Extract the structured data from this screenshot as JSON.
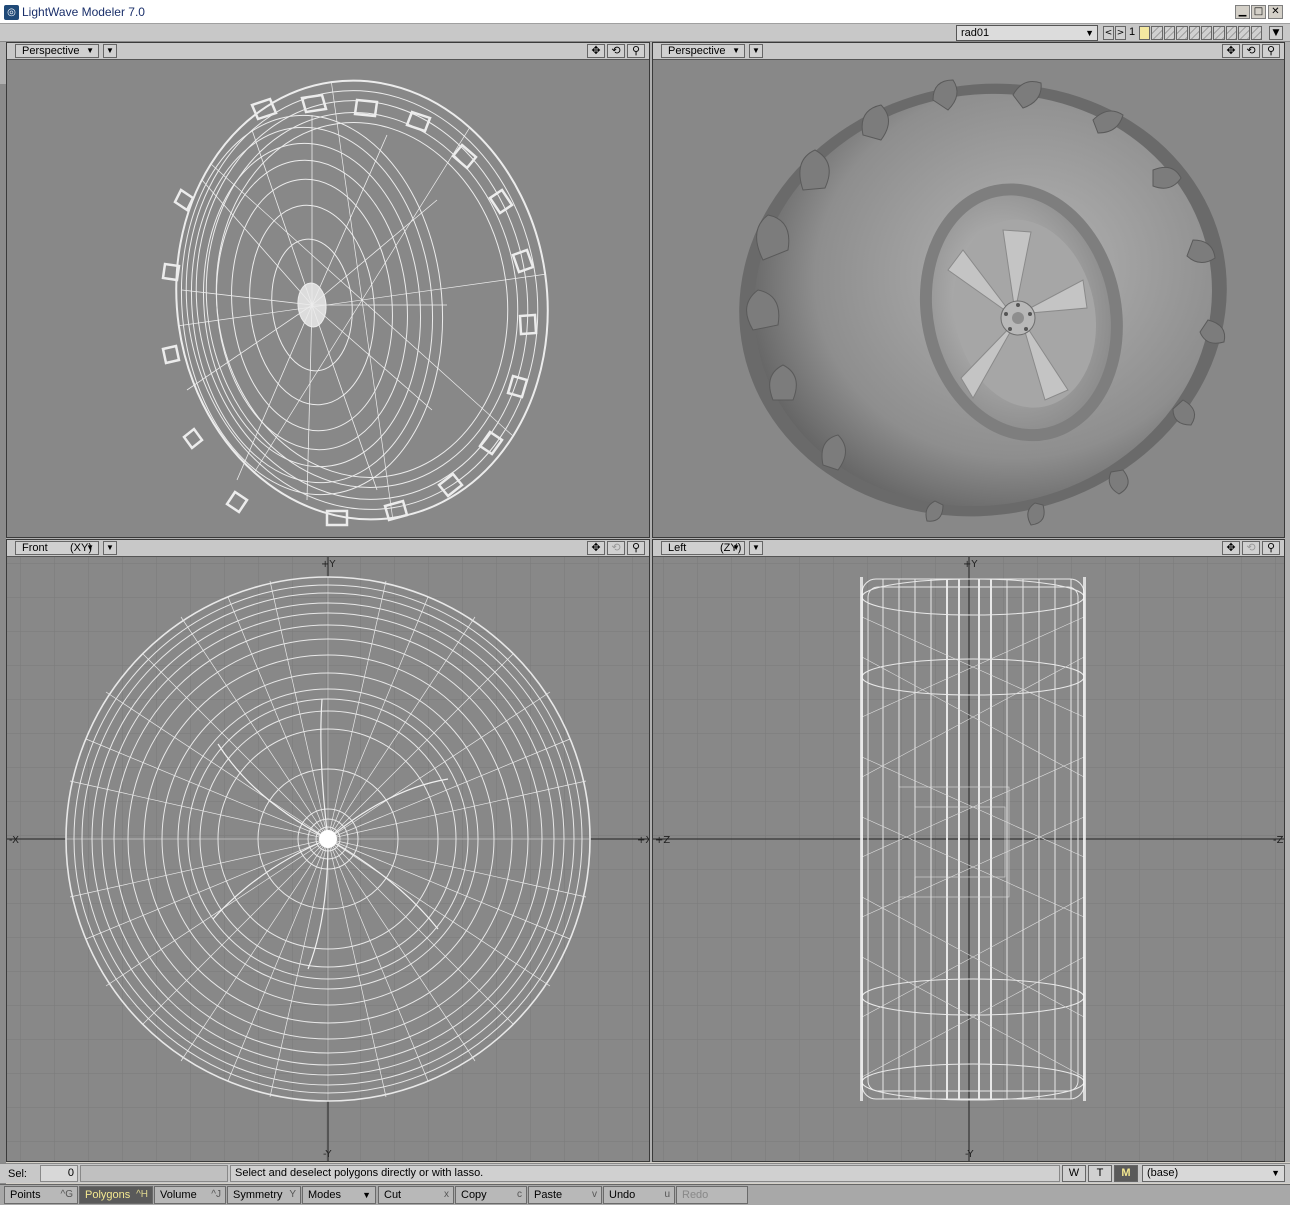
{
  "window": {
    "title": "LightWave Modeler 7.0",
    "minimize": "▁",
    "maximize": "□",
    "close": "✕"
  },
  "topbar": {
    "layer_name": "rad01",
    "layer_number": "1",
    "prev": "<",
    "next": ">"
  },
  "viewports": {
    "top_left": {
      "view": "Perspective",
      "axis": ""
    },
    "top_right": {
      "view": "Perspective",
      "axis": ""
    },
    "bottom_left": {
      "view": "Front",
      "axis": "(XY)",
      "h_neg": "-X",
      "h_pos": "+X",
      "v_pos": "+Y",
      "v_neg": "-Y"
    },
    "bottom_right": {
      "view": "Left",
      "axis": "(ZY)",
      "h_neg": "+Z",
      "h_pos": "-Z",
      "v_pos": "+Y",
      "v_neg": "-Y"
    }
  },
  "icons": {
    "dropdown": "chevron-down-icon",
    "move": "pan-icon",
    "rotate": "rotate-icon",
    "zoom": "magnifier-icon"
  },
  "status": {
    "sel_label": "Sel:",
    "sel_count": "0",
    "hint": "Select and deselect polygons directly or with lasso.",
    "w": "W",
    "t": "T",
    "m": "M",
    "layer": "(base)"
  },
  "toolbar": [
    {
      "label": "Points",
      "key": "^G"
    },
    {
      "label": "Polygons",
      "key": "^H"
    },
    {
      "label": "Volume",
      "key": "^J"
    },
    {
      "label": "Symmetry",
      "key": "Y"
    },
    {
      "label": "Modes",
      "key": ""
    },
    {
      "label": "Cut",
      "key": "x"
    },
    {
      "label": "Copy",
      "key": "c"
    },
    {
      "label": "Paste",
      "key": "v"
    },
    {
      "label": "Undo",
      "key": "u"
    },
    {
      "label": "Redo",
      "key": ""
    }
  ],
  "colors": {
    "viewport_bg": "#888888",
    "wire": "#e6e6e6",
    "shaded": "#9a9a9a",
    "active_button": "#5a5a5a",
    "active_text": "#f4e890"
  }
}
